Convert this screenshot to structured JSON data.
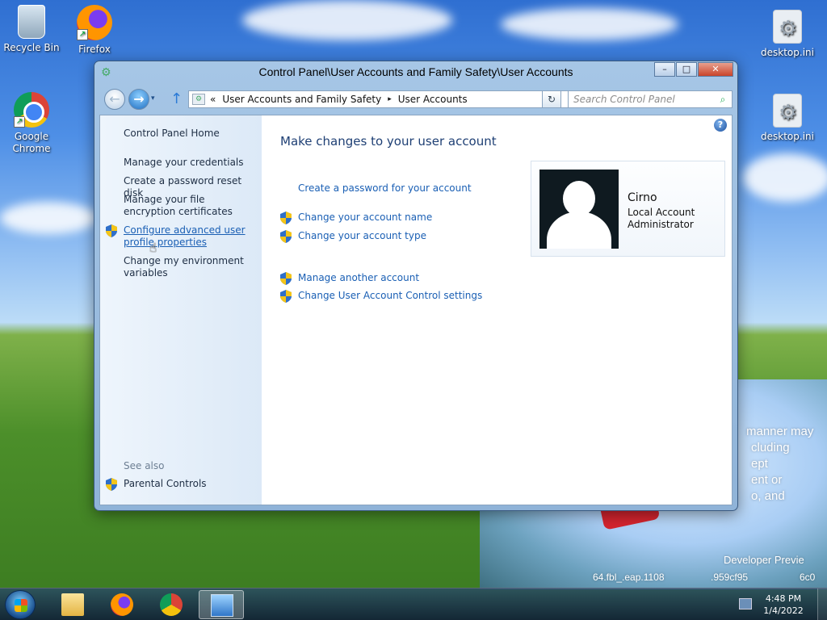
{
  "desktop": {
    "icons": [
      {
        "label": "Recycle Bin",
        "icon": "recycle-bin-icon"
      },
      {
        "label": "Firefox",
        "icon": "firefox-icon"
      },
      {
        "label": "Google Chrome",
        "icon": "chrome-icon"
      },
      {
        "label": "desktop.ini",
        "icon": "settings-file-icon"
      },
      {
        "label": "desktop.ini",
        "icon": "settings-file-icon"
      }
    ],
    "wallpaper_text": [
      "manner may",
      "cluding",
      "ept",
      "ent or",
      "o, and",
      "Developer Previe",
      "64.fbl_.eap.1108",
      ".959cf95",
      "6c0"
    ]
  },
  "window": {
    "title": "Control Panel\\User Accounts and Family Safety\\User Accounts",
    "controls": {
      "minimize": "–",
      "maximize": "□",
      "close": "✕"
    },
    "nav": {
      "back_glyph": "←",
      "forward_glyph": "→",
      "history_glyph": "▾",
      "up_glyph": "↑",
      "breadcrumb_chevron": "«",
      "breadcrumb": [
        "User Accounts and Family Safety",
        "User Accounts"
      ],
      "breadcrumb_separator": "▸",
      "address_dropdown_glyph": "▾",
      "refresh_glyph": "↻",
      "search_placeholder": "Search Control Panel",
      "search_glyph": "⌕"
    },
    "left_pane": {
      "home": "Control Panel Home",
      "links": [
        "Manage your credentials",
        "Create a password reset disk",
        "Manage your file encryption certificates",
        "Configure advanced user profile properties",
        "Change my environment variables"
      ],
      "see_also_label": "See also",
      "see_also": [
        "Parental Controls"
      ]
    },
    "main": {
      "help_glyph": "?",
      "heading": "Make changes to your user account",
      "tasks_primary": [
        "Create a password for your account",
        "Change your account name",
        "Change your account type"
      ],
      "tasks_secondary": [
        "Manage another account",
        "Change User Account Control settings"
      ],
      "account": {
        "name": "Cirno",
        "type": "Local Account",
        "role": "Administrator"
      }
    }
  },
  "taskbar": {
    "pinned": [
      "file-explorer-icon",
      "firefox-icon",
      "chrome-icon",
      "control-panel-icon"
    ],
    "clock": {
      "time": "4:48 PM",
      "date": "1/4/2022"
    }
  },
  "colors": {
    "link": "#1a5fb4",
    "heading": "#1e3f74",
    "titlebar": "#a6c6e6"
  }
}
